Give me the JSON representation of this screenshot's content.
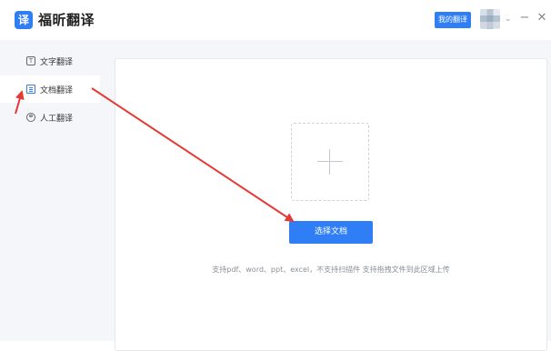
{
  "app": {
    "logo_glyph": "译",
    "title": "福昕翻译"
  },
  "header": {
    "my_translate_label": "我的翻译",
    "minimize_glyph": "−",
    "close_glyph": "✕",
    "caret_glyph": "⌄"
  },
  "sidebar": {
    "items": [
      {
        "label": "文字翻译",
        "icon": "text-icon",
        "icon_glyph": "T",
        "active": false
      },
      {
        "label": "文档翻译",
        "icon": "document-icon",
        "icon_glyph": "",
        "active": true
      },
      {
        "label": "人工翻译",
        "icon": "human-translate-icon",
        "icon_glyph": "",
        "active": false
      }
    ]
  },
  "main": {
    "upload_button_label": "选择文档",
    "hint": "支持pdf、word、ppt、excel，不支持扫描件 支持拖拽文件到此区域上传"
  },
  "colors": {
    "accent": "#2f7ef5",
    "annotation": "#e53935"
  }
}
